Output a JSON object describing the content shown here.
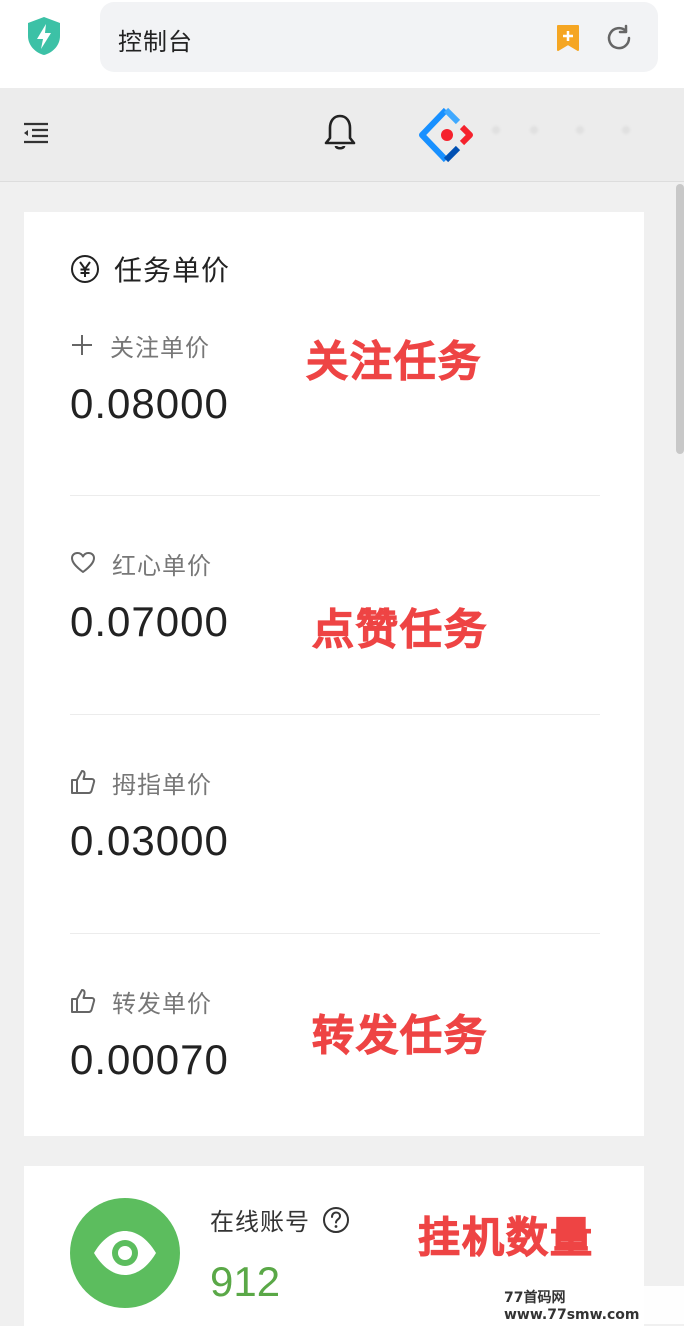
{
  "browser": {
    "url_text": "控制台"
  },
  "card": {
    "title": "任务单价",
    "items": [
      {
        "label": "关注单价",
        "value": "0.08000",
        "icon": "plus-icon",
        "annotation": "关注任务"
      },
      {
        "label": "红心单价",
        "value": "0.07000",
        "icon": "heart-icon",
        "annotation": "点赞任务"
      },
      {
        "label": "拇指单价",
        "value": "0.03000",
        "icon": "thumbs-up-icon",
        "annotation": ""
      },
      {
        "label": "转发单价",
        "value": "0.00070",
        "icon": "thumbs-up-icon",
        "annotation": "转发任务"
      }
    ]
  },
  "stats": {
    "online_label": "在线账号",
    "online_value": "912",
    "annotation": "挂机数量"
  },
  "watermark": "77首码网 www.77smw.com",
  "colors": {
    "accent_green": "#5cbd5e",
    "annotation_red": "#ee4444",
    "shield_teal": "#3cc1a6",
    "bookmark_orange": "#f5a623"
  }
}
